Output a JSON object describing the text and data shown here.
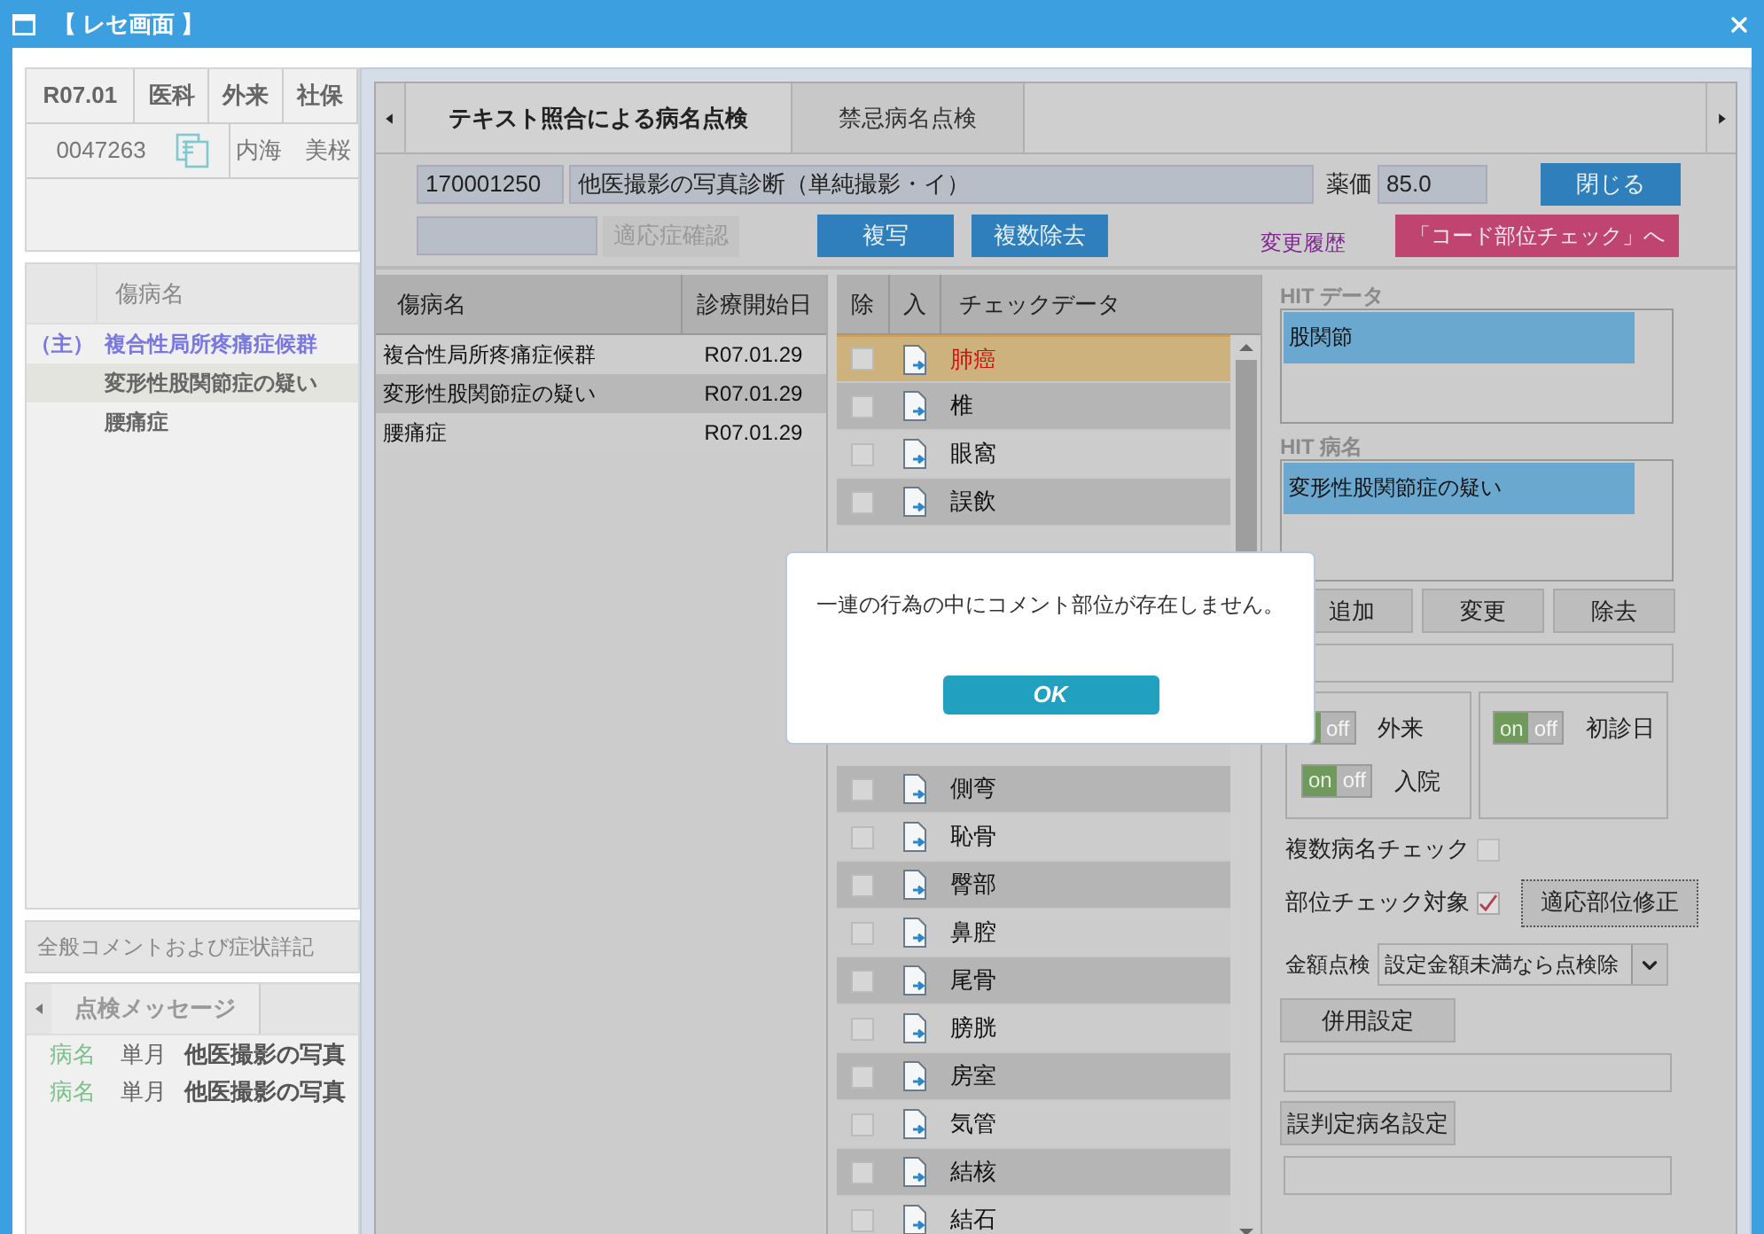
{
  "window": {
    "title": "【 レセ画面 】"
  },
  "receipt": {
    "header": [
      "R07.01",
      "医科",
      "外来",
      "社保"
    ],
    "patient_id": "0047263",
    "patient_name": "内海　美桜"
  },
  "disease_list": {
    "column": "傷病名",
    "rows": [
      {
        "marker": "（主）",
        "name": "複合性局所疼痛症候群",
        "primary": true,
        "selected": false
      },
      {
        "name": "変形性股関節症の疑い",
        "primary": false,
        "selected": true
      },
      {
        "name": "腰痛症",
        "primary": false,
        "selected": false
      }
    ]
  },
  "general_comment": "全般コメントおよび症状詳記",
  "message_tabs": [
    {
      "label": "点検メッセージ",
      "selected": true
    }
  ],
  "messages": [
    {
      "category": "病名",
      "period": "単月",
      "text": "他医撮影の写真"
    },
    {
      "category": "病名",
      "period": "単月",
      "text": "他医撮影の写真"
    }
  ],
  "check_panel": {
    "tabs": [
      {
        "label": "テキスト照合による病名点検",
        "selected": true
      },
      {
        "label": "禁忌病名点検",
        "selected": false
      }
    ],
    "code": "170001250",
    "procedure": "他医撮影の写真診断（単純撮影・イ）",
    "price_label": "薬価",
    "price": "85.0",
    "close_button": "閉じる",
    "indication_button": {
      "label": "適応症確認",
      "disabled": true
    },
    "buttons": [
      "複写",
      "複数除去"
    ],
    "history_link": "変更履歴",
    "code_check_button": "「コード部位チェック」へ",
    "diseases": {
      "columns": [
        "傷病名",
        "診療開始日"
      ],
      "rows": [
        {
          "name": "複合性局所疼痛症候群",
          "date": "R07.01.29",
          "selected": false
        },
        {
          "name": "変形性股関節症の疑い",
          "date": "R07.01.29",
          "selected": true
        },
        {
          "name": "腰痛症",
          "date": "R07.01.29",
          "selected": false
        }
      ]
    },
    "check_data": {
      "columns": [
        "除",
        "入",
        "チェックデータ"
      ],
      "rows_above": [
        {
          "label": "肺癌",
          "checked": false,
          "selected": true
        },
        {
          "label": "椎",
          "checked": false,
          "selected": false
        },
        {
          "label": "眼窩",
          "checked": false,
          "selected": false
        },
        {
          "label": "誤飲",
          "checked": false,
          "selected": false
        }
      ],
      "rows_below": [
        {
          "label": "側弯",
          "checked": false,
          "selected": false
        },
        {
          "label": "恥骨",
          "checked": false,
          "selected": false
        },
        {
          "label": "臀部",
          "checked": false,
          "selected": false
        },
        {
          "label": "鼻腔",
          "checked": false,
          "selected": false
        },
        {
          "label": "尾骨",
          "checked": false,
          "selected": false
        },
        {
          "label": "膀胱",
          "checked": false,
          "selected": false
        },
        {
          "label": "房室",
          "checked": false,
          "selected": false
        },
        {
          "label": "気管",
          "checked": false,
          "selected": false
        },
        {
          "label": "結核",
          "checked": false,
          "selected": false
        },
        {
          "label": "結石",
          "checked": false,
          "selected": false
        }
      ]
    },
    "hit_data": {
      "label": "HIT データ",
      "items": [
        "股関節"
      ]
    },
    "hit_disease": {
      "label": "HIT 病名",
      "items": [
        "変形性股関節症の疑い"
      ]
    },
    "edit_buttons": [
      "追加",
      "変更",
      "除去"
    ],
    "toggle_groups": [
      [
        {
          "label": "外来",
          "off_text": "off",
          "on": true
        },
        {
          "label": "入院",
          "on_text": "on",
          "off_text": "off",
          "on": true
        }
      ],
      [
        {
          "label": "初診日",
          "on_text": "on",
          "off_text": "off",
          "on": true
        }
      ]
    ],
    "multi_check": {
      "label": "複数病名チェック",
      "checked": false
    },
    "site_check": {
      "label": "部位チェック対象",
      "checked": true
    },
    "site_fix_button": "適応部位修正",
    "amount_check": {
      "label": "金額点検",
      "value": "設定金額未満なら点検除"
    },
    "combo_button": "併用設定",
    "misjudge_button": "誤判定病名設定"
  },
  "dialog": {
    "message": "一連の行為の中にコメント部位が存在しません。",
    "ok": "OK"
  }
}
